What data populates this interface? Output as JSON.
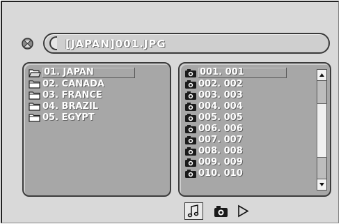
{
  "title": "[JAPAN]001.JPG",
  "folders": [
    {
      "label": "01. JAPAN",
      "selected": true
    },
    {
      "label": "02. CANADA"
    },
    {
      "label": "03. FRANCE"
    },
    {
      "label": "04. BRAZIL"
    },
    {
      "label": "05. EGYPT"
    }
  ],
  "files": [
    {
      "label": "001. 001",
      "selected": true
    },
    {
      "label": "002. 002"
    },
    {
      "label": "003. 003"
    },
    {
      "label": "004. 004"
    },
    {
      "label": "005. 005"
    },
    {
      "label": "006. 006"
    },
    {
      "label": "007. 007"
    },
    {
      "label": "008. 008"
    },
    {
      "label": "009. 009"
    },
    {
      "label": "010. 010"
    }
  ],
  "icons": {
    "header": "disc-icon",
    "folder": "folder-icon",
    "file": "camera-icon",
    "modes": [
      "music-note-icon",
      "camera-icon",
      "play-icon"
    ]
  },
  "colors": {
    "background": "#d9d9d9",
    "panel": "#a7a7a7",
    "text": "#ffffff"
  }
}
